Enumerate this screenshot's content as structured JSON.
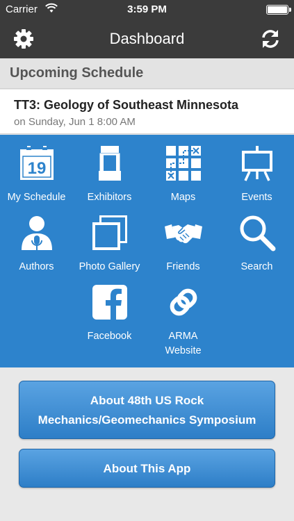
{
  "status_bar": {
    "carrier": "Carrier",
    "time": "3:59 PM"
  },
  "nav": {
    "title": "Dashboard",
    "left_icon": "gear-icon",
    "right_icon": "refresh-icon"
  },
  "upcoming": {
    "header": "Upcoming Schedule",
    "title": "TT3: Geology of Southeast Minnesota",
    "date": "on Sunday, Jun 1 8:00 AM"
  },
  "calendar_day": "19",
  "tiles": [
    {
      "label": "My Schedule",
      "icon": "calendar-icon"
    },
    {
      "label": "Exhibitors",
      "icon": "booth-icon"
    },
    {
      "label": "Maps",
      "icon": "map-grid-icon"
    },
    {
      "label": "Events",
      "icon": "easel-icon"
    },
    {
      "label": "Authors",
      "icon": "speaker-icon"
    },
    {
      "label": "Photo Gallery",
      "icon": "photos-icon"
    },
    {
      "label": "Friends",
      "icon": "handshake-icon"
    },
    {
      "label": "Search",
      "icon": "search-icon"
    },
    {
      "label": "Facebook",
      "icon": "facebook-icon"
    },
    {
      "label_line1": "ARMA",
      "label_line2": "Website",
      "icon": "link-icon"
    }
  ],
  "buttons": {
    "about_symposium_line1": "About 48th US Rock",
    "about_symposium_line2": "Mechanics/Geomechanics Symposium",
    "about_app": "About This App"
  },
  "colors": {
    "bar": "#3b3b3b",
    "grid_blue": "#2d83cc",
    "button_blue": "#3a8ad3"
  }
}
